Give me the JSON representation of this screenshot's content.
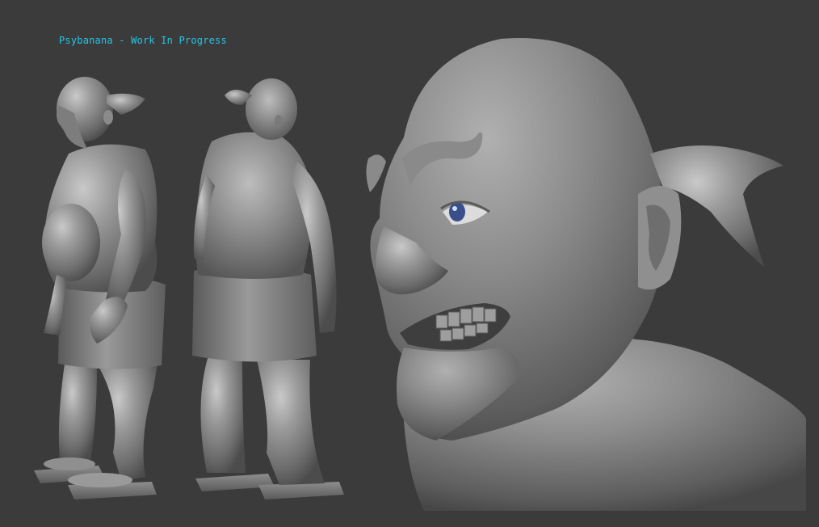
{
  "viewport": {
    "title": "Psybanana - Work In Progress",
    "background": "#3b3b3b",
    "title_color": "#25c6e8",
    "clay_color": "#8a8a8a",
    "eye_color": "#3a4f8a"
  }
}
